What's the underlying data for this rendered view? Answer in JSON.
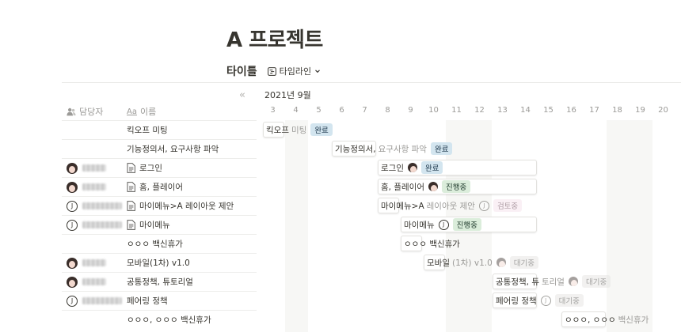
{
  "page": {
    "title": "A 프로젝트"
  },
  "view": {
    "title": "타이틀",
    "switch_label": "타임라인"
  },
  "table": {
    "owner_header": "담당자",
    "name_header": "이름",
    "name_header_prefix": "Aa"
  },
  "timeline": {
    "month": "2021년 9월",
    "days": [
      "3",
      "4",
      "5",
      "6",
      "7",
      "8",
      "9",
      "10",
      "11",
      "12",
      "13",
      "14",
      "15",
      "16",
      "17",
      "18",
      "19",
      "20"
    ]
  },
  "rows": [
    {
      "owner": "none",
      "name": "킥오프 미팅",
      "doc": false,
      "bar_in": "킥오프",
      "bar_out": "미팅",
      "status": "완료",
      "status_kind": "done"
    },
    {
      "owner": "none",
      "name": "기능정의서, 요구사항 파악",
      "doc": false,
      "bar_in": "기능정의서,",
      "bar_out": "요구사항 파악",
      "status": "완료",
      "status_kind": "done"
    },
    {
      "owner": "face",
      "name": "로그인",
      "doc": true,
      "bar_in": "로그인",
      "bar_out": "",
      "status": "완료",
      "status_kind": "done"
    },
    {
      "owner": "face",
      "name": "홈, 플레이어",
      "doc": true,
      "bar_in": "홈, 플레이어",
      "bar_out": "",
      "status": "진행중",
      "status_kind": "prog"
    },
    {
      "owner": "j",
      "name": "마이메뉴>A 레이아웃 제안",
      "doc": true,
      "bar_in": "마이메뉴>A",
      "bar_out": "레이아웃 제안",
      "status": "검토중",
      "status_kind": "review"
    },
    {
      "owner": "j",
      "name": "마이메뉴",
      "doc": true,
      "bar_in": "마이메뉴",
      "bar_out": "",
      "status": "진행중",
      "status_kind": "prog"
    },
    {
      "owner": "none",
      "name": "ㅇㅇㅇ 백신휴가",
      "doc": false,
      "bar_in": "ㅇㅇㅇ 백신휴가",
      "bar_out": "",
      "status": "",
      "status_kind": ""
    },
    {
      "owner": "face",
      "name": "모바일(1차) v1.0",
      "doc": false,
      "bar_in": "모바일",
      "bar_out": "(1차) v1.0",
      "status": "대기중",
      "status_kind": "wait"
    },
    {
      "owner": "face",
      "name": "공통정책, 튜토리얼",
      "doc": false,
      "bar_in": "공통정책, 튜",
      "bar_out": "토리얼",
      "status": "대기중",
      "status_kind": "wait"
    },
    {
      "owner": "j",
      "name": "페어링 정책",
      "doc": false,
      "bar_in": "페어링 정책",
      "bar_out": "",
      "status": "대기중",
      "status_kind": "wait"
    },
    {
      "owner": "none",
      "name": "ㅇㅇㅇ, ㅇㅇㅇ 백신휴가",
      "doc": false,
      "bar_in": "ㅇㅇㅇ, ㅇㅇㅇ",
      "bar_out": "백신휴가",
      "status": "",
      "status_kind": ""
    }
  ]
}
